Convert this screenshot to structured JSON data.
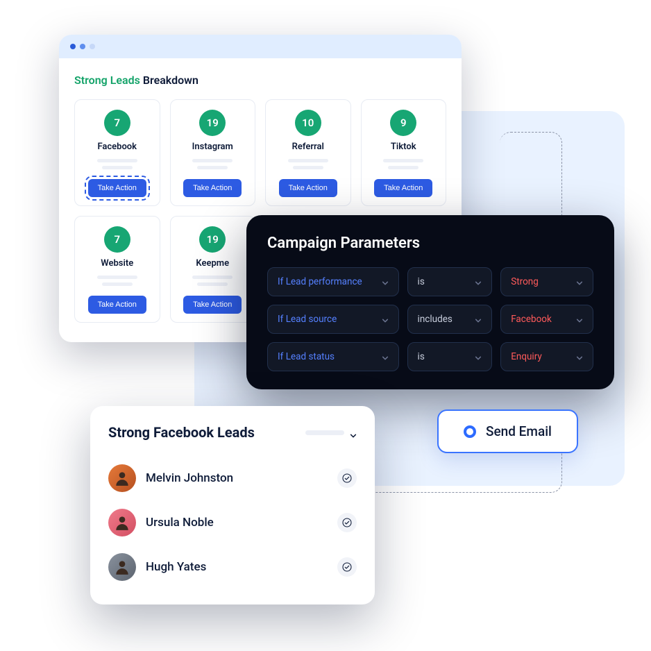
{
  "breakdown": {
    "title_accent": "Strong Leads",
    "title_rest": " Breakdown",
    "cards": [
      {
        "count": "7",
        "label": "Facebook",
        "action": "Take Action",
        "focused": true
      },
      {
        "count": "19",
        "label": "Instagram",
        "action": "Take Action",
        "focused": false
      },
      {
        "count": "10",
        "label": "Referral",
        "action": "Take Action",
        "focused": false
      },
      {
        "count": "9",
        "label": "Tiktok",
        "action": "Take Action",
        "focused": false
      },
      {
        "count": "7",
        "label": "Website",
        "action": "Take Action",
        "focused": false
      },
      {
        "count": "19",
        "label": "Keepme",
        "action": "Take Action",
        "focused": false
      }
    ]
  },
  "params": {
    "title": "Campaign Parameters",
    "rows": [
      {
        "field": "If Lead performance",
        "op": "is",
        "value": "Strong"
      },
      {
        "field": "If Lead source",
        "op": "includes",
        "value": "Facebook"
      },
      {
        "field": "If Lead status",
        "op": "is",
        "value": "Enquiry"
      }
    ]
  },
  "send_email": {
    "label": "Send Email"
  },
  "leads_list": {
    "title": "Strong Facebook Leads",
    "items": [
      {
        "name": "Melvin Johnston"
      },
      {
        "name": "Ursula Noble"
      },
      {
        "name": "Hugh Yates"
      }
    ]
  }
}
